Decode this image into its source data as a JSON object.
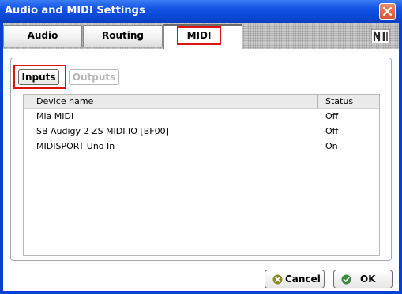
{
  "window": {
    "title": "Audio and MIDI Settings"
  },
  "tabs": [
    {
      "label": "Audio"
    },
    {
      "label": "Routing"
    },
    {
      "label": "MIDI"
    }
  ],
  "midi": {
    "subtabs": {
      "inputs": "Inputs",
      "outputs": "Outputs"
    },
    "columns": {
      "name": "Device name",
      "status": "Status"
    },
    "rows": [
      {
        "name": "Mia MIDI",
        "status": "Off"
      },
      {
        "name": "SB Audigy 2 ZS MIDI IO [BF00]",
        "status": "Off"
      },
      {
        "name": "MIDISPORT Uno In",
        "status": "On"
      }
    ]
  },
  "footer": {
    "cancel": "Cancel",
    "ok": "OK"
  },
  "colors": {
    "title_bar": "#0a48d8",
    "highlight": "#e01212",
    "ok_icon": "#3a8a3a",
    "cancel_icon": "#8a8a2a"
  }
}
